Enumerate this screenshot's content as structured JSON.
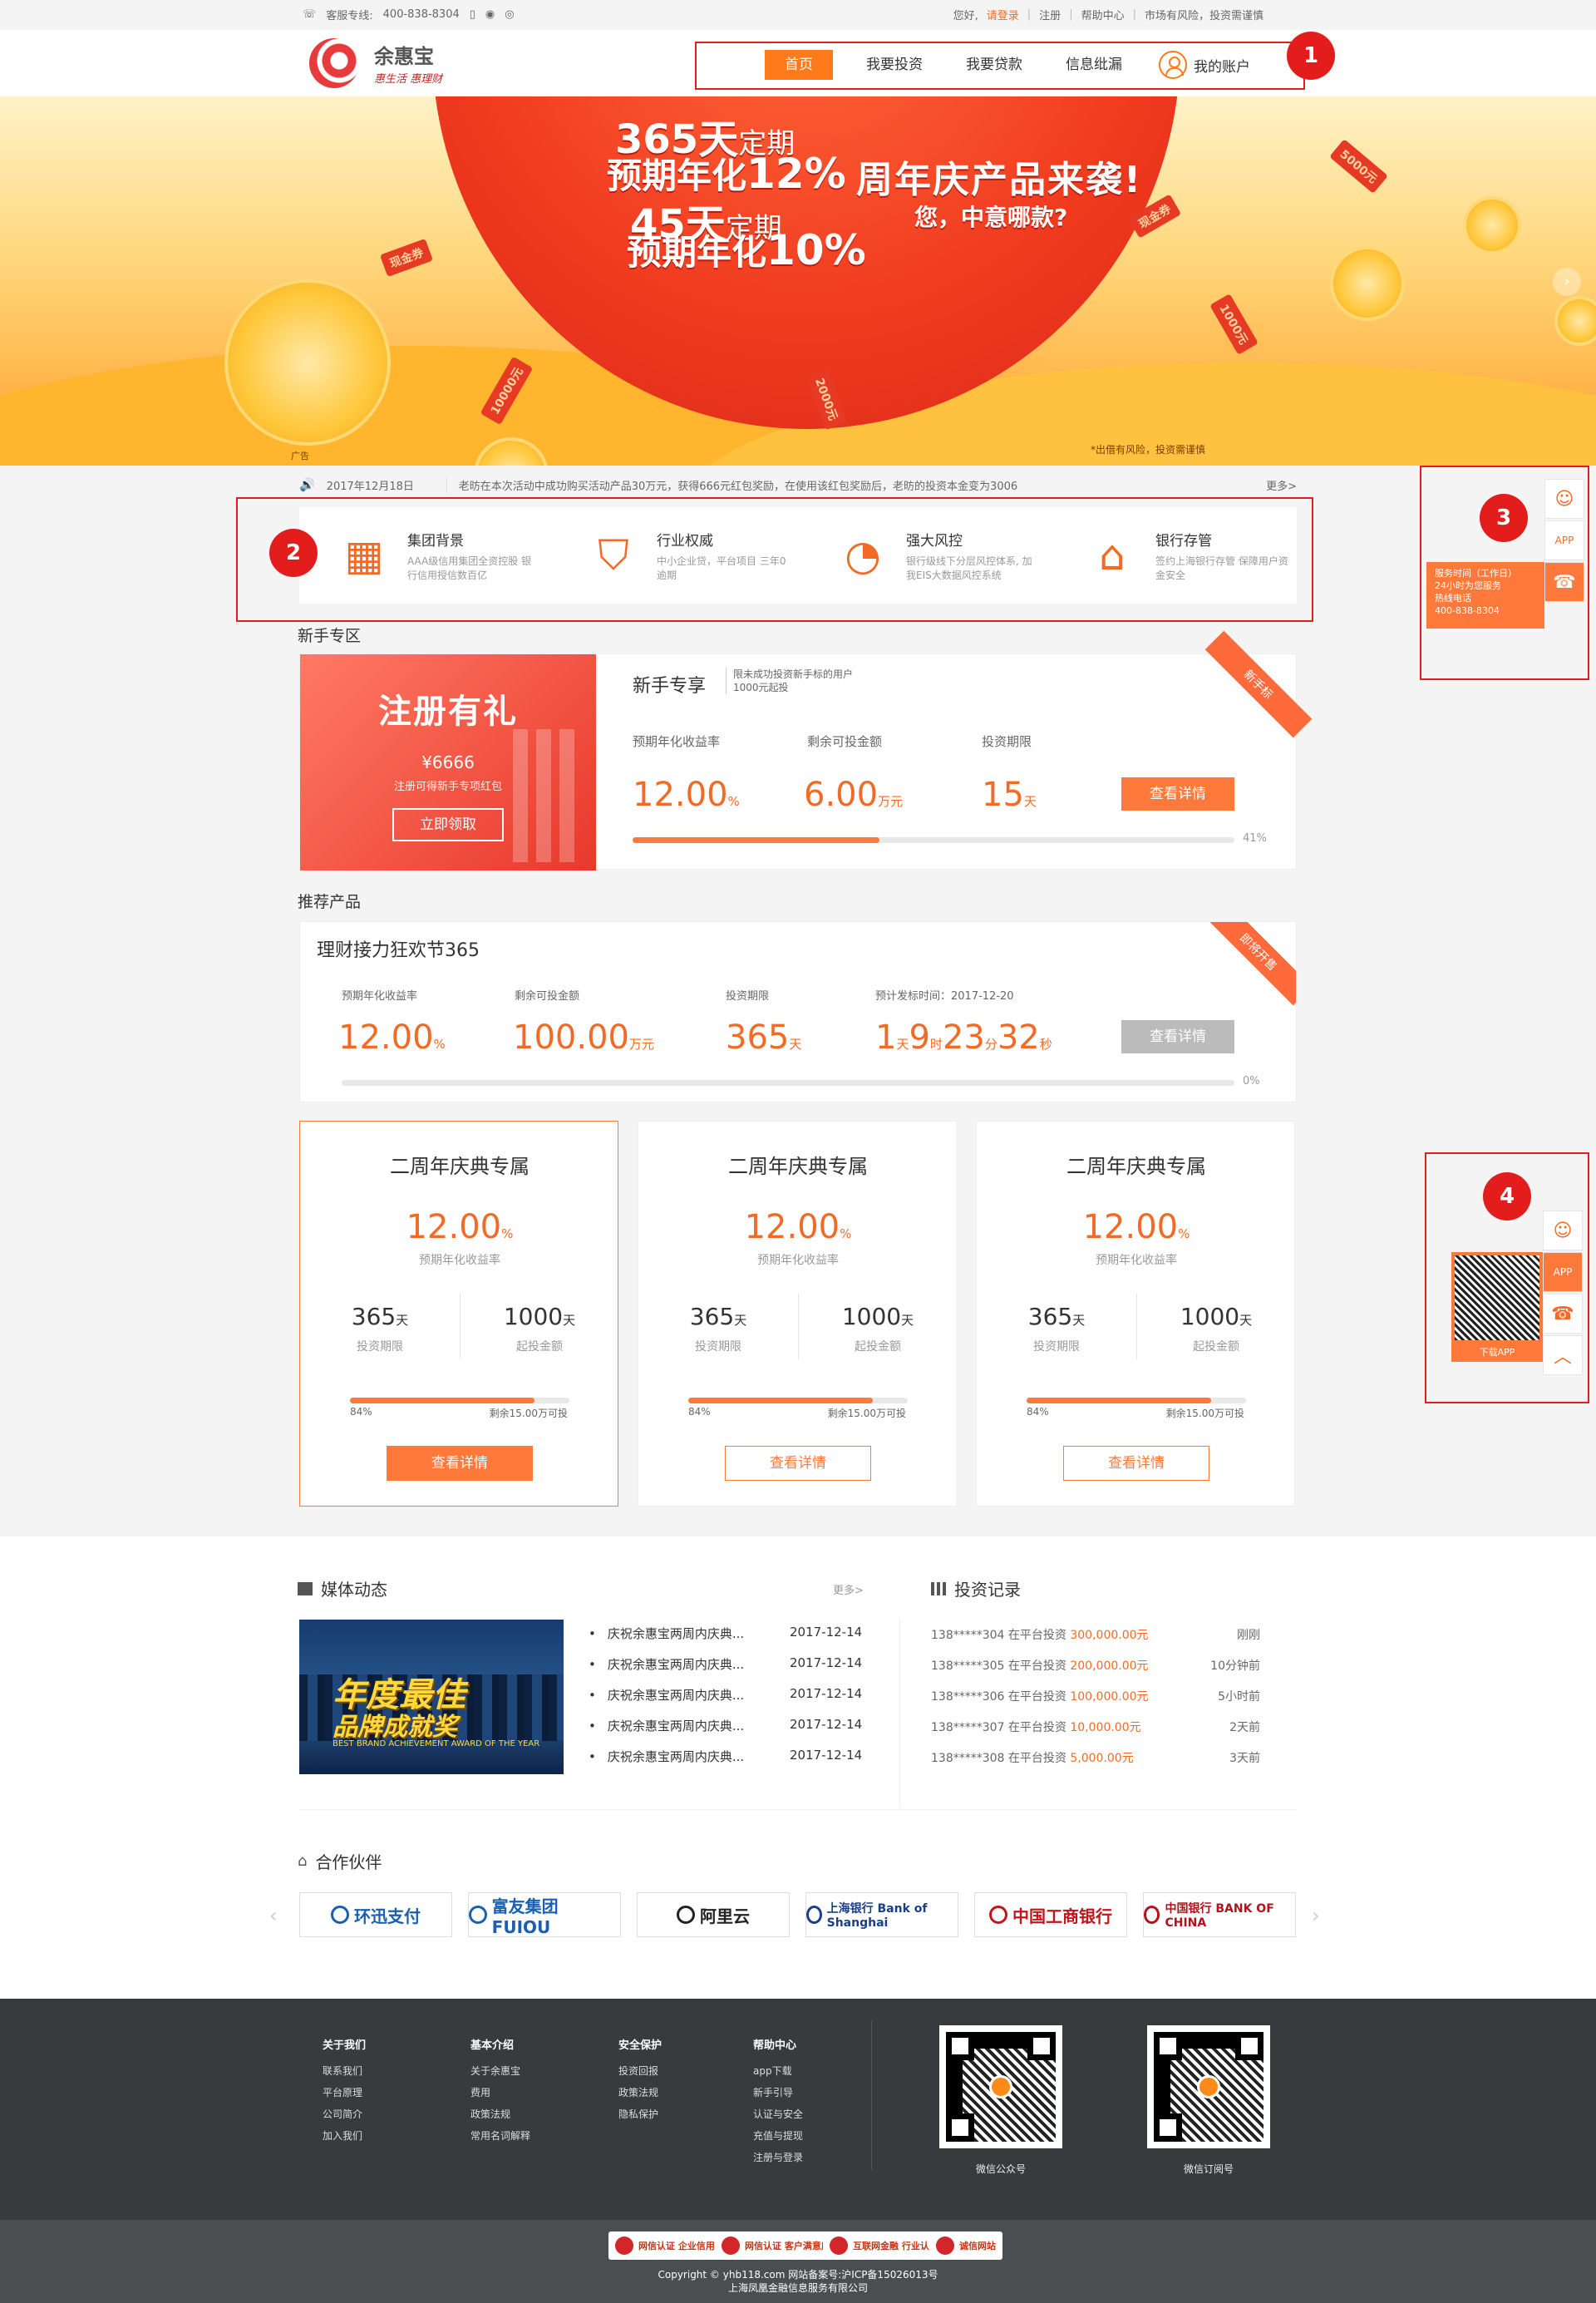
{
  "topbar": {
    "hotline_label": "客服专线:",
    "hotline": "400-838-8304",
    "greeting": "您好,",
    "login": "请登录",
    "register": "注册",
    "help": "帮助中心",
    "risk": "市场有风险，投资需谨慎"
  },
  "logo": {
    "name": "余惠宝",
    "slogan": "惠生活 惠理财"
  },
  "nav": {
    "items": [
      "首页",
      "我要投资",
      "我要贷款",
      "信息纰漏"
    ],
    "account": "我的账户"
  },
  "annotations": [
    "1",
    "2",
    "3",
    "4"
  ],
  "banner": {
    "line1_a": "365天",
    "line1_b": "定期",
    "line2_a": "预期年化",
    "line2_b": "12%",
    "line3_a": "45天",
    "line3_b": "定期",
    "line4_a": "预期年化",
    "line4_b": "10%",
    "headline": "周年庆产品来袭!",
    "subline": "您，中意哪款?",
    "tickets": [
      "现金券",
      "5000元",
      "1000元",
      "10000元",
      "2000元",
      "现金券"
    ],
    "note": "*出借有风险，投资需谨慎",
    "ad_tag": "广告"
  },
  "ticker": {
    "date": "2017年12月18日",
    "message": "老昉在本次活动中成功购买活动产品30万元，获得666元红包奖励，在使用该红包奖励后，老昉的投资本金变为3006",
    "more": "更多>"
  },
  "features": [
    {
      "icon": "building-icon",
      "title": "集团背景",
      "desc": "AAA级信用集团全资控股 银行信用授信数百亿"
    },
    {
      "icon": "shield-icon",
      "title": "行业权威",
      "desc": "中小企业贷，平台项目 三年0逾期"
    },
    {
      "icon": "gauge-icon",
      "title": "强大风控",
      "desc": "银行级线下分层风控体系, 加我EIS大数据风控系统"
    },
    {
      "icon": "bank-icon",
      "title": "银行存管",
      "desc": "签约上海银行存管 保障用户资金安全"
    }
  ],
  "newbie": {
    "section": "新手专区",
    "promo_title": "注册有礼",
    "promo_amount": "¥6666",
    "promo_sub": "注册可得新手专项红包",
    "promo_btn": "立即领取",
    "title": "新手专享",
    "note": "限未成功投资新手标的用户 1000元起投",
    "ribbon": "新手标",
    "rate_label": "预期年化收益率",
    "rate": "12.00",
    "rate_unit": "%",
    "remain_label": "剩余可投金额",
    "remain": "6.00",
    "remain_unit": "万元",
    "term_label": "投资期限",
    "term": "15",
    "term_unit": "天",
    "btn": "查看详情",
    "progress": 0.41,
    "progress_text": "41%"
  },
  "recommend": {
    "section": "推荐产品",
    "title": "理财接力狂欢节365",
    "ribbon": "即将开售",
    "rate_label": "预期年化收益率",
    "rate": "12.00",
    "rate_unit": "%",
    "remain_label": "剩余可投金额",
    "remain": "100.00",
    "remain_unit": "万元",
    "term_label": "投资期限",
    "term": "365",
    "term_unit": "天",
    "time_label": "预计发标时间：2017-12-20",
    "cd": [
      "1",
      "天",
      "9",
      "时",
      "23",
      "分",
      "32",
      "秒"
    ],
    "btn": "查看详情",
    "progress": 0,
    "progress_text": "0%"
  },
  "cards": [
    {
      "title": "二周年庆典专属",
      "rate": "12.00",
      "rate_unit": "%",
      "rate_label": "预期年化收益率",
      "term": "365",
      "term_unit": "天",
      "term_label": "投资期限",
      "min": "1000",
      "min_unit": "天",
      "min_label": "起投金额",
      "progress": 0.84,
      "pct": "84%",
      "remain": "剩余15.00万可投",
      "btn": "查看详情"
    },
    {
      "title": "二周年庆典专属",
      "rate": "12.00",
      "rate_unit": "%",
      "rate_label": "预期年化收益率",
      "term": "365",
      "term_unit": "天",
      "term_label": "投资期限",
      "min": "1000",
      "min_unit": "天",
      "min_label": "起投金额",
      "progress": 0.84,
      "pct": "84%",
      "remain": "剩余15.00万可投",
      "btn": "查看详情"
    },
    {
      "title": "二周年庆典专属",
      "rate": "12.00",
      "rate_unit": "%",
      "rate_label": "预期年化收益率",
      "term": "365",
      "term_unit": "天",
      "term_label": "投资期限",
      "min": "1000",
      "min_unit": "天",
      "min_label": "起投金额",
      "progress": 0.84,
      "pct": "84%",
      "remain": "剩余15.00万可投",
      "btn": "查看详情"
    }
  ],
  "media": {
    "title": "媒体动态",
    "more": "更多>",
    "image_text1": "年度最佳",
    "image_text2": "品牌成就奖",
    "image_text3": "BEST BRAND ACHIEVEMENT AWARD OF THE YEAR",
    "items": [
      {
        "title": "庆祝余惠宝两周内庆典...",
        "date": "2017-12-14"
      },
      {
        "title": "庆祝余惠宝两周内庆典...",
        "date": "2017-12-14"
      },
      {
        "title": "庆祝余惠宝两周内庆典...",
        "date": "2017-12-14"
      },
      {
        "title": "庆祝余惠宝两周内庆典...",
        "date": "2017-12-14"
      },
      {
        "title": "庆祝余惠宝两周内庆典...",
        "date": "2017-12-14"
      }
    ]
  },
  "invest": {
    "title": "投资记录",
    "items": [
      {
        "user": "138*****304",
        "mid": "在平台投资",
        "amount": "300,000.00元",
        "time": "刚刚"
      },
      {
        "user": "138*****305",
        "mid": "在平台投资",
        "amount": "200,000.00元",
        "time": "10分钟前"
      },
      {
        "user": "138*****306",
        "mid": "在平台投资",
        "amount": "100,000.00元",
        "time": "5小时前"
      },
      {
        "user": "138*****307",
        "mid": "在平台投资",
        "amount": "10,000.00元",
        "time": "2天前"
      },
      {
        "user": "138*****308",
        "mid": "在平台投资",
        "amount": "5,000.00元",
        "time": "3天前"
      }
    ]
  },
  "partners": {
    "title": "合作伙伴",
    "items": [
      {
        "name": "环迅支付",
        "color": "#1a5fb0"
      },
      {
        "name": "富友集团 FUIOU",
        "color": "#1a5fb0"
      },
      {
        "name": "阿里云",
        "color": "#222222"
      },
      {
        "name": "上海银行 Bank of Shanghai",
        "color": "#1a3f8a"
      },
      {
        "name": "中国工商银行",
        "color": "#c3161c"
      },
      {
        "name": "中国银行 BANK OF CHINA",
        "color": "#b1121b"
      }
    ]
  },
  "footer": {
    "cols": [
      {
        "h": "关于我们",
        "items": [
          "联系我们",
          "平台原理",
          "公司简介",
          "加入我们"
        ]
      },
      {
        "h": "基本介绍",
        "items": [
          "关于余惠宝",
          "费用",
          "政策法规",
          "常用名词解释"
        ]
      },
      {
        "h": "安全保护",
        "items": [
          "投资回报",
          "政策法规",
          "隐私保护"
        ]
      },
      {
        "h": "帮助中心",
        "items": [
          "app下载",
          "新手引导",
          "认证与安全",
          "充值与提现",
          "注册与登录"
        ]
      }
    ],
    "qr1": "微信公众号",
    "qr2": "微信订阅号",
    "certs": [
      "网信认证 企业信用评级",
      "网信认证 客户满意度测评",
      "互联网金融 行业认证",
      "诚信网站"
    ],
    "copyright": "Copyright © yhb118.com 网站备案号:沪ICP备15026013号",
    "company": "上海凤凰金融信息服务有限公司"
  },
  "side": {
    "service_time": "服务时间（工作日）",
    "service_hours": "24小时为您服务",
    "hotline_label": "热线电话",
    "hotline": "400-838-8304",
    "app_label": "APP",
    "download": "下载APP"
  }
}
